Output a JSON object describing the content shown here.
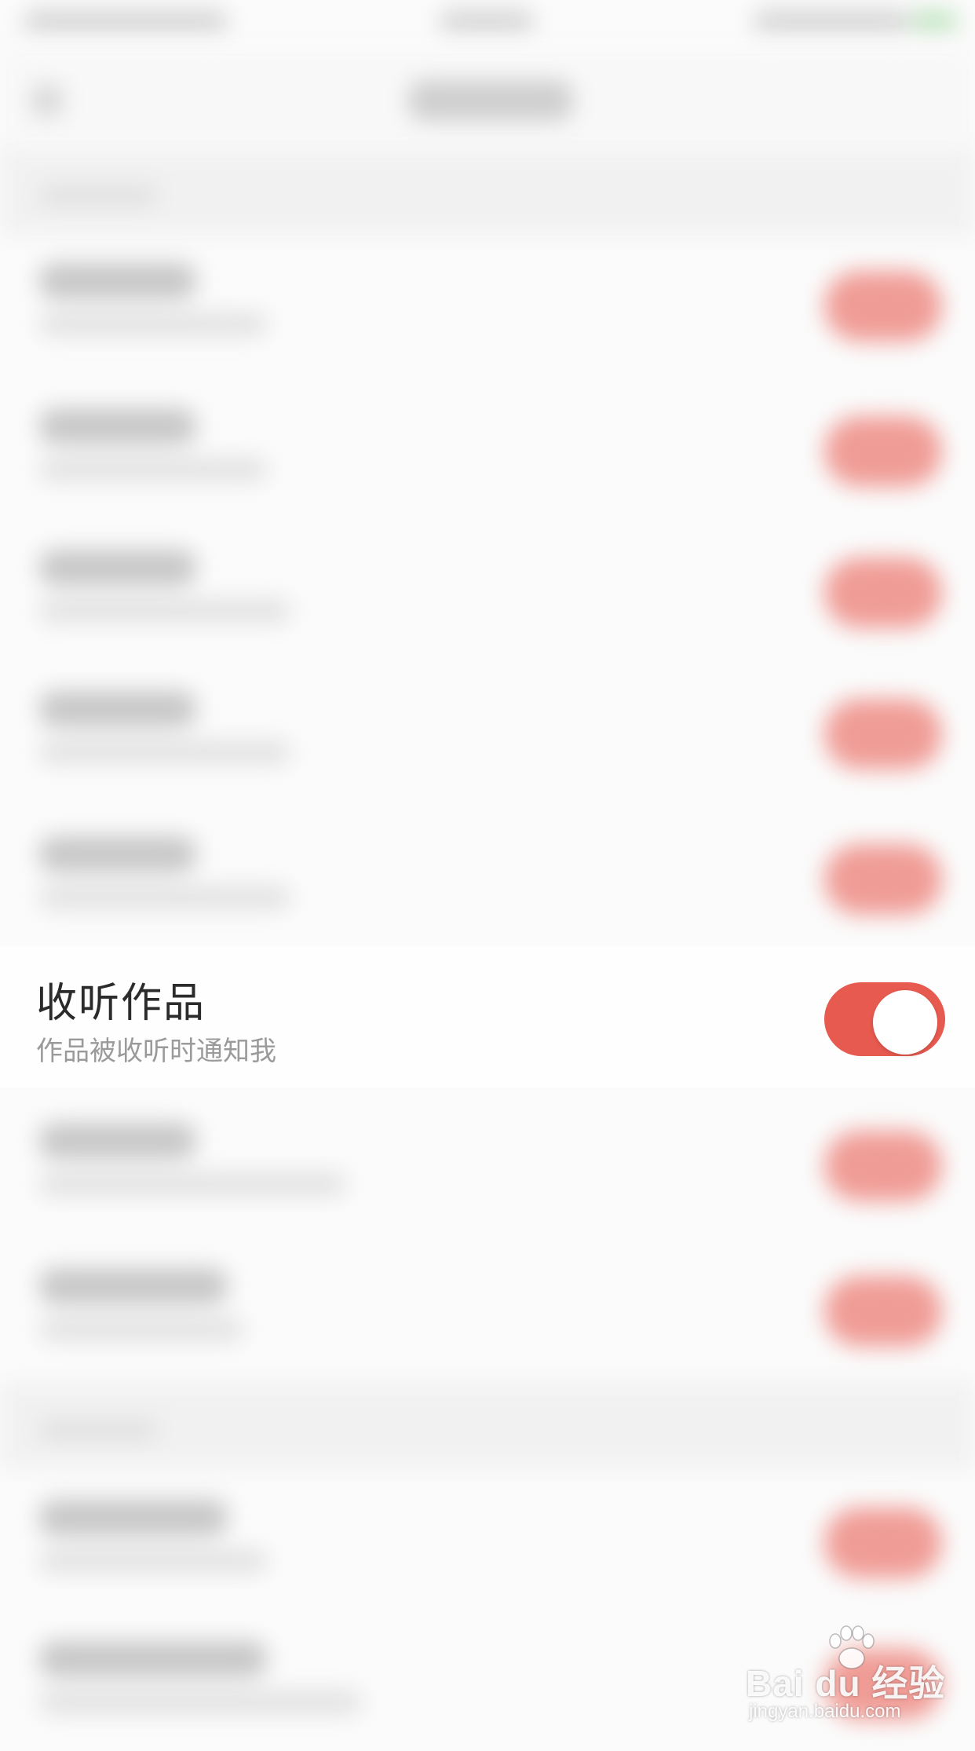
{
  "focused_setting": {
    "title": "收听作品",
    "subtitle": "作品被收听时通知我",
    "toggle_on": true,
    "toggle_color": "#e65a4f"
  },
  "watermark": {
    "brand": "Bai du 经验",
    "url": "jingyan.baidu.com"
  },
  "colors": {
    "accent": "#e65a4f",
    "background": "#fbfbfb"
  }
}
